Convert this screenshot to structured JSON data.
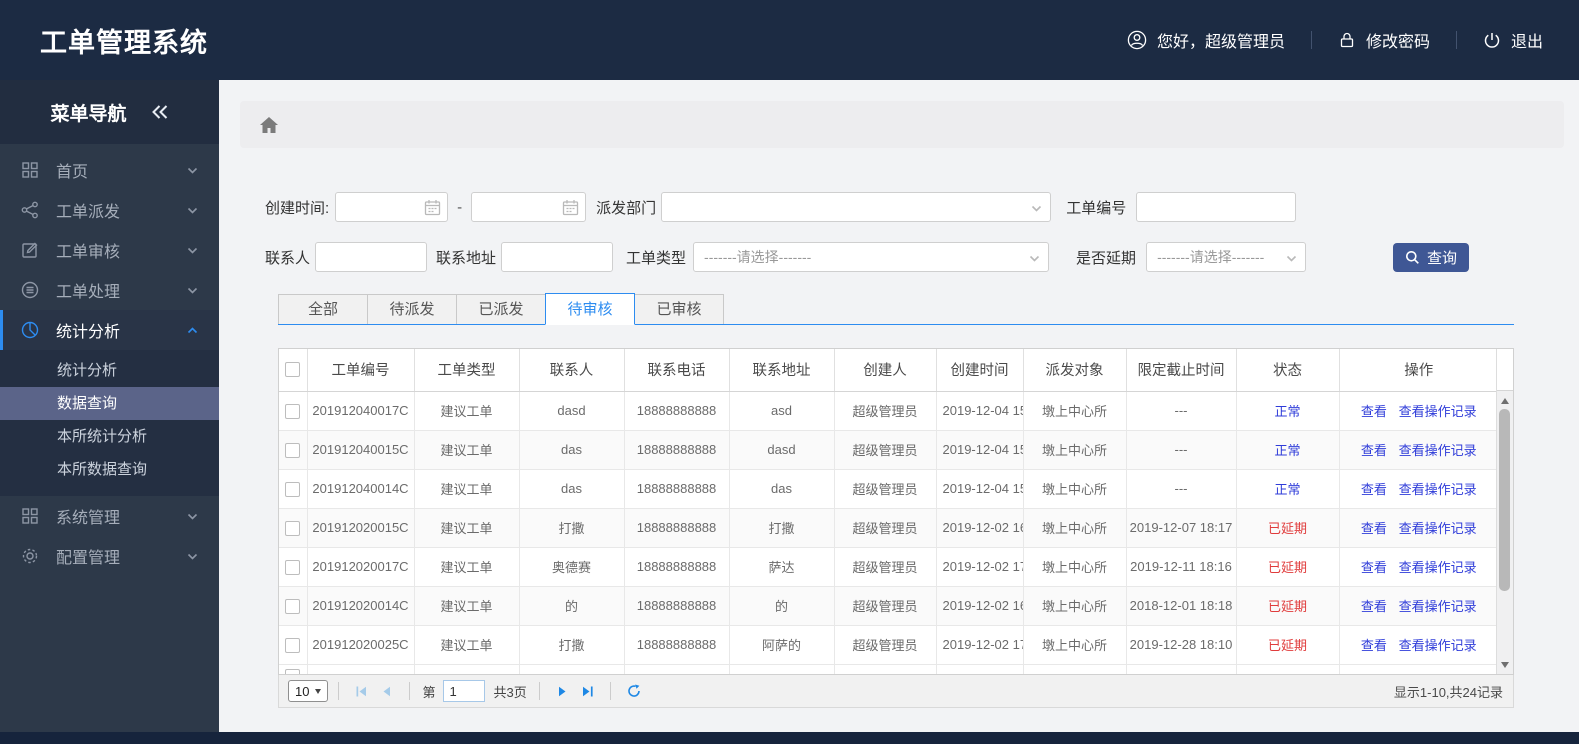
{
  "app": {
    "title": "工单管理系统"
  },
  "topbar": {
    "greeting": "您好，超级管理员",
    "change_password": "修改密码",
    "logout": "退出"
  },
  "sidebar": {
    "title": "菜单导航",
    "items": [
      {
        "label": "首页",
        "icon": "grid-icon",
        "expanded": false
      },
      {
        "label": "工单派发",
        "icon": "share-icon",
        "expanded": false
      },
      {
        "label": "工单审核",
        "icon": "edit-icon",
        "expanded": false
      },
      {
        "label": "工单处理",
        "icon": "process-icon",
        "expanded": false
      },
      {
        "label": "统计分析",
        "icon": "pie-chart-icon",
        "expanded": true
      },
      {
        "label": "系统管理",
        "icon": "grid-icon",
        "expanded": false
      },
      {
        "label": "配置管理",
        "icon": "gear-icon",
        "expanded": false
      }
    ],
    "submenu": [
      {
        "label": "统计分析",
        "selected": false
      },
      {
        "label": "数据查询",
        "selected": true
      },
      {
        "label": "本所统计分析",
        "selected": false
      },
      {
        "label": "本所数据查询",
        "selected": false
      }
    ]
  },
  "filters": {
    "created_time": {
      "label": "创建时间:",
      "value_from": "",
      "value_to": "",
      "separator": "-"
    },
    "dispatch_dept": {
      "label": "派发部门",
      "value": ""
    },
    "order_no": {
      "label": "工单编号",
      "value": ""
    },
    "contact": {
      "label": "联系人",
      "value": ""
    },
    "address": {
      "label": "联系地址",
      "value": ""
    },
    "order_type": {
      "label": "工单类型",
      "value": "-------请选择-------"
    },
    "is_delayed": {
      "label": "是否延期",
      "value": "-------请选择-------"
    },
    "search_button": "查询"
  },
  "tabs": [
    {
      "label": "全部",
      "active": false
    },
    {
      "label": "待派发",
      "active": false
    },
    {
      "label": "已派发",
      "active": false
    },
    {
      "label": "待审核",
      "active": true
    },
    {
      "label": "已审核",
      "active": false
    }
  ],
  "table": {
    "headers": [
      "工单编号",
      "工单类型",
      "联系人",
      "联系电话",
      "联系地址",
      "创建人",
      "创建时间",
      "派发对象",
      "限定截止时间",
      "状态",
      "操作"
    ],
    "actions": {
      "view": "查看",
      "view_log": "查看操作记录"
    },
    "rows": [
      {
        "order_no": "201912040017C",
        "type": "建议工单",
        "contact": "dasd",
        "phone": "18888888888",
        "address": "asd",
        "creator": "超级管理员",
        "created": "2019-12-04 15",
        "target": "墩上中心所",
        "deadline": "---",
        "status": "正常"
      },
      {
        "order_no": "201912040015C",
        "type": "建议工单",
        "contact": "das",
        "phone": "18888888888",
        "address": "dasd",
        "creator": "超级管理员",
        "created": "2019-12-04 15",
        "target": "墩上中心所",
        "deadline": "---",
        "status": "正常"
      },
      {
        "order_no": "201912040014C",
        "type": "建议工单",
        "contact": "das",
        "phone": "18888888888",
        "address": "das",
        "creator": "超级管理员",
        "created": "2019-12-04 15",
        "target": "墩上中心所",
        "deadline": "---",
        "status": "正常"
      },
      {
        "order_no": "201912020015C",
        "type": "建议工单",
        "contact": "打撒",
        "phone": "18888888888",
        "address": "打撒",
        "creator": "超级管理员",
        "created": "2019-12-02 16",
        "target": "墩上中心所",
        "deadline": "2019-12-07 18:17",
        "status": "已延期"
      },
      {
        "order_no": "201912020017C",
        "type": "建议工单",
        "contact": "奥德赛",
        "phone": "18888888888",
        "address": "萨达",
        "creator": "超级管理员",
        "created": "2019-12-02 17",
        "target": "墩上中心所",
        "deadline": "2019-12-11 18:16",
        "status": "已延期"
      },
      {
        "order_no": "201912020014C",
        "type": "建议工单",
        "contact": "的",
        "phone": "18888888888",
        "address": "的",
        "creator": "超级管理员",
        "created": "2019-12-02 16",
        "target": "墩上中心所",
        "deadline": "2018-12-01 18:18",
        "status": "已延期"
      },
      {
        "order_no": "201912020025C",
        "type": "建议工单",
        "contact": "打撒",
        "phone": "18888888888",
        "address": "阿萨的",
        "creator": "超级管理员",
        "created": "2019-12-02 17",
        "target": "墩上中心所",
        "deadline": "2019-12-28 18:10",
        "status": "已延期"
      }
    ]
  },
  "pagination": {
    "page_size": "10",
    "page_prefix": "第",
    "current_page": "1",
    "total_pages": "共3页",
    "summary": "显示1-10,共24记录"
  },
  "colors": {
    "header_bg": "#1c2b43",
    "sidebar_bg": "#2d3949",
    "submenu_selected_bg": "#5b6489",
    "accent_blue": "#2d8cf0",
    "link_blue": "#2f3cd9",
    "status_normal": "#2f3cd9",
    "status_delayed": "#e03c3c",
    "search_button_bg": "#3f5795"
  },
  "icons": {
    "user-icon": "user",
    "lock-icon": "lock",
    "power-icon": "power",
    "collapse-icon": "double-chevron-left",
    "home-icon": "home",
    "calendar-icon": "calendar",
    "chevron-down-icon": "chevron-down",
    "search-icon": "magnifier",
    "refresh-icon": "refresh"
  }
}
